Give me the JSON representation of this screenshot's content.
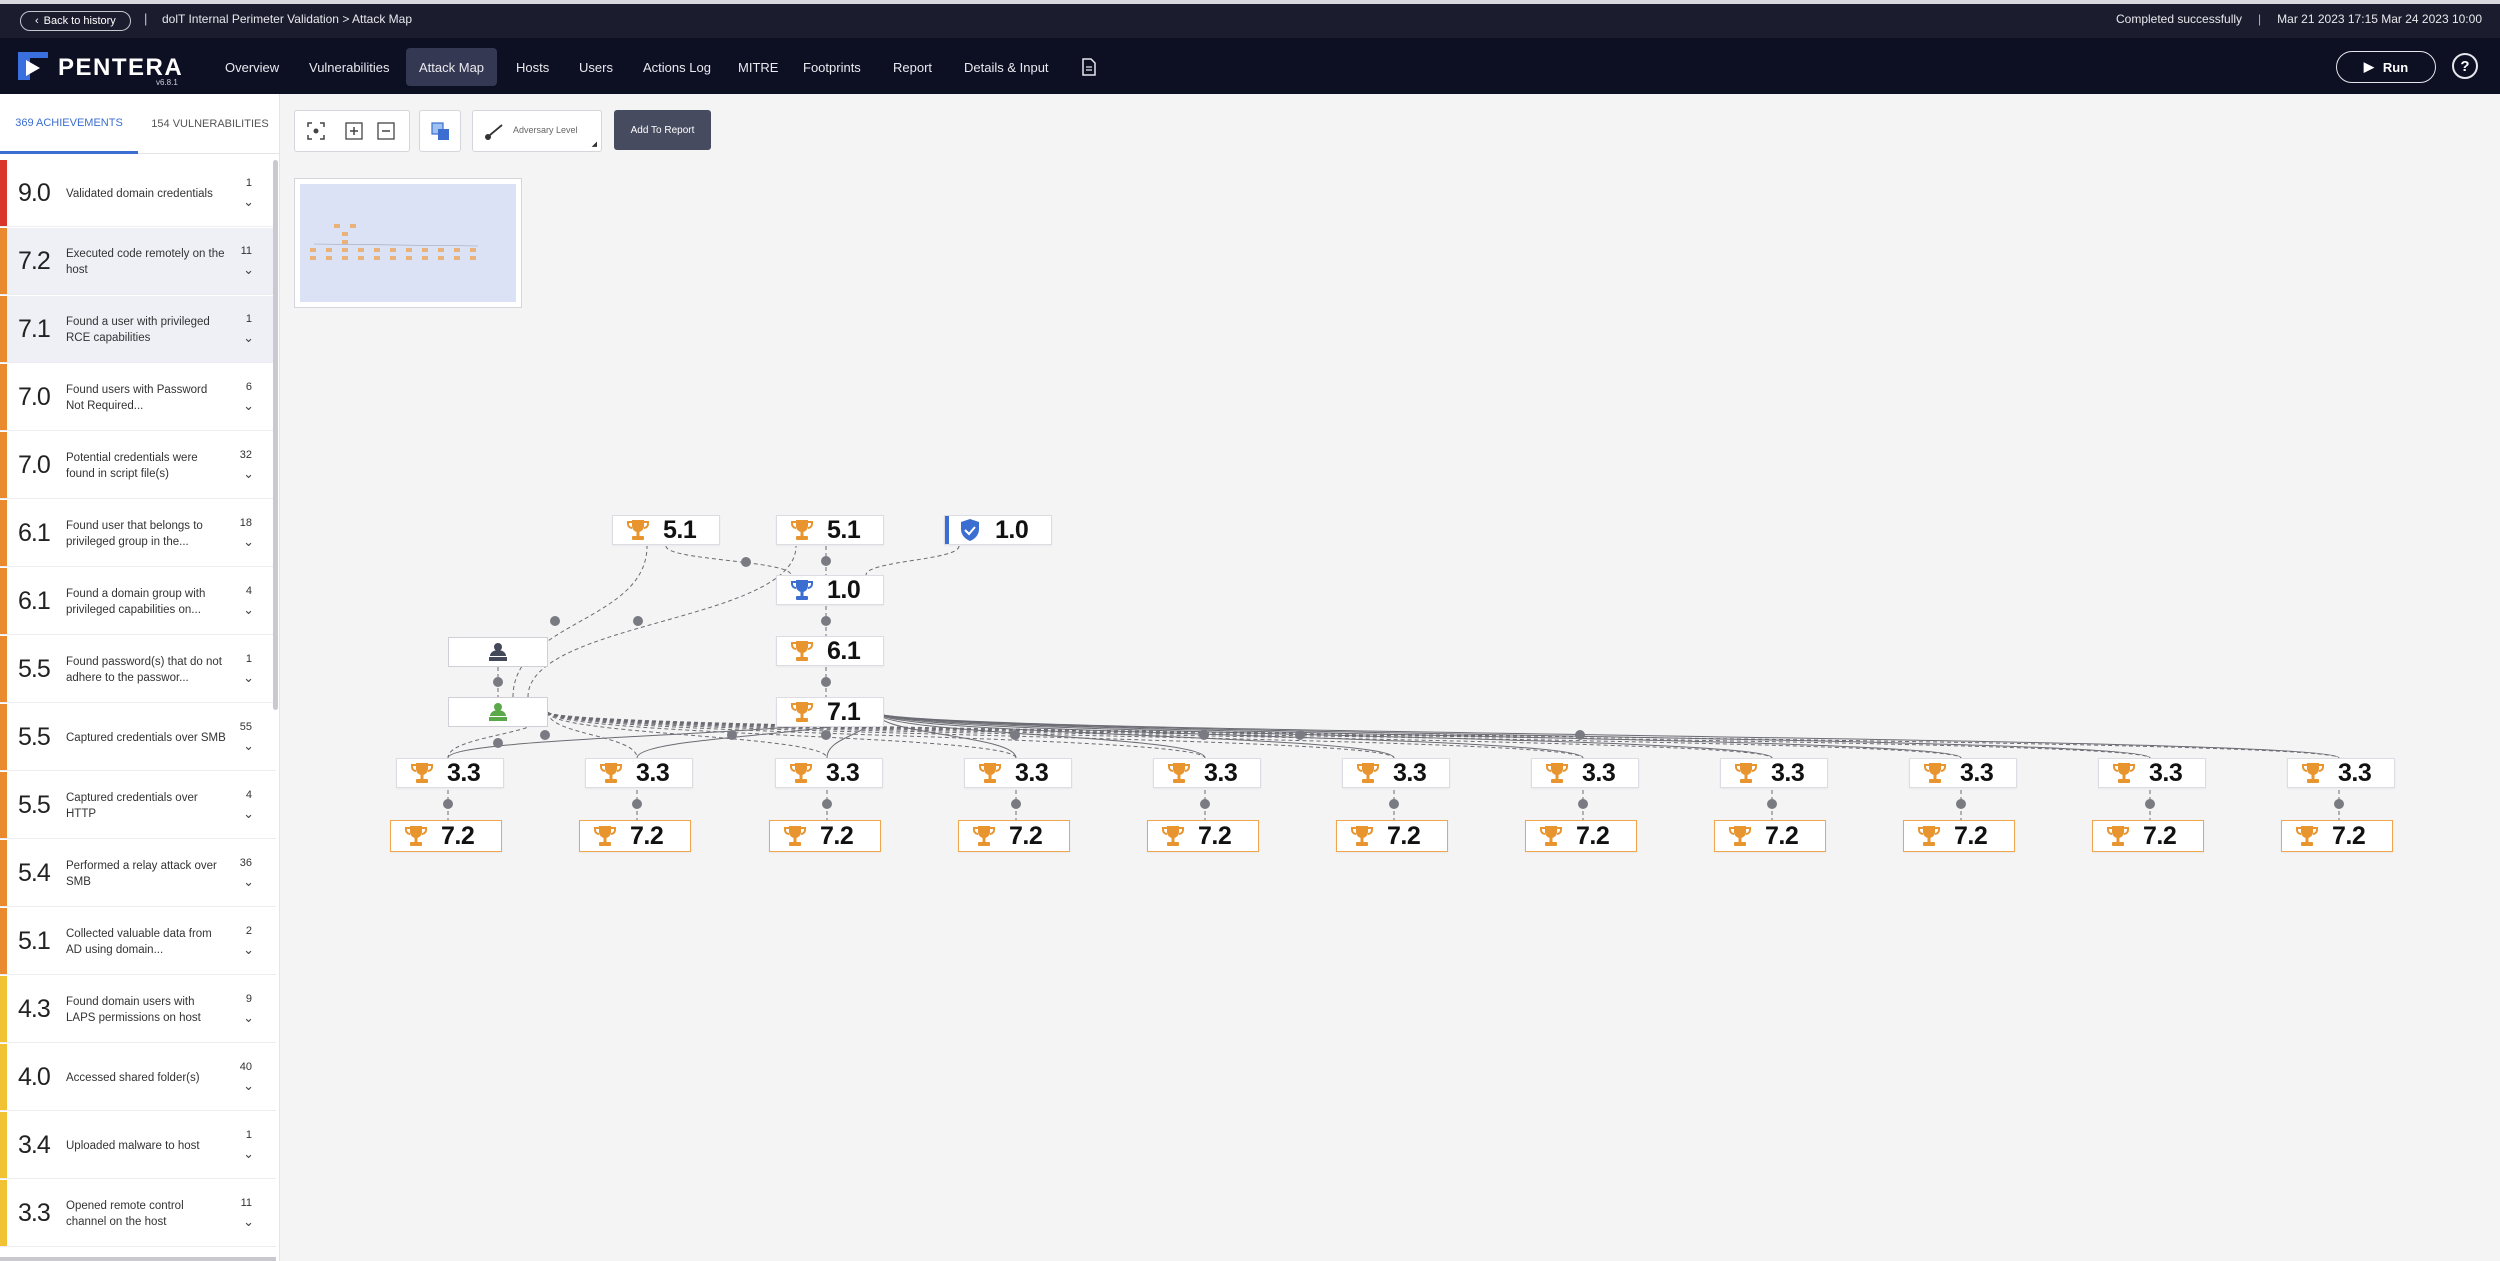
{
  "topbar": {
    "back_label": "Back to history",
    "breadcrumb": "dolT Internal Perimeter Validation > Attack Map",
    "status": "Completed successfully",
    "dates": "Mar 21 2023 17:15  Mar 24 2023 10:00"
  },
  "brand": {
    "name": "PENTERA",
    "version": "v6.8.1"
  },
  "nav": {
    "items": [
      "Overview",
      "Vulnerabilities",
      "Attack Map",
      "Hosts",
      "Users",
      "Actions Log",
      "MITRE",
      "Footprints",
      "Report",
      "Details & Input"
    ],
    "active": "Attack Map",
    "run_label": "Run",
    "help_label": "?"
  },
  "panel": {
    "tabs": [
      "369 ACHIEVEMENTS",
      "154 VULNERABILITIES"
    ],
    "achievements": [
      {
        "score": "9.0",
        "title": "Validated domain credentials",
        "count": "1",
        "color": "#d9362b"
      },
      {
        "score": "7.2",
        "title": "Executed code remotely on the host",
        "count": "11",
        "color": "#e98a2e"
      },
      {
        "score": "7.1",
        "title": "Found a user with privileged RCE capabilities",
        "count": "1",
        "color": "#e98a2e"
      },
      {
        "score": "7.0",
        "title": "Found users with Password Not Required...",
        "count": "6",
        "color": "#e98a2e"
      },
      {
        "score": "7.0",
        "title": "Potential credentials were found in script file(s)",
        "count": "32",
        "color": "#e98a2e"
      },
      {
        "score": "6.1",
        "title": "Found user that belongs to privileged group in the...",
        "count": "18",
        "color": "#e98a2e"
      },
      {
        "score": "6.1",
        "title": "Found a domain group with privileged capabilities on...",
        "count": "4",
        "color": "#e98a2e"
      },
      {
        "score": "5.5",
        "title": "Found password(s) that do not adhere to the passwor...",
        "count": "1",
        "color": "#e98a2e"
      },
      {
        "score": "5.5",
        "title": "Captured credentials over SMB",
        "count": "55",
        "color": "#e98a2e"
      },
      {
        "score": "5.5",
        "title": "Captured credentials over HTTP",
        "count": "4",
        "color": "#e98a2e"
      },
      {
        "score": "5.4",
        "title": "Performed a relay attack over SMB",
        "count": "36",
        "color": "#e98a2e"
      },
      {
        "score": "5.1",
        "title": "Collected valuable data from AD using domain...",
        "count": "2",
        "color": "#e98a2e"
      },
      {
        "score": "4.3",
        "title": "Found domain users with LAPS permissions on host",
        "count": "9",
        "color": "#f2c235"
      },
      {
        "score": "4.0",
        "title": "Accessed shared folder(s)",
        "count": "40",
        "color": "#f2c235"
      },
      {
        "score": "3.4",
        "title": "Uploaded malware to host",
        "count": "1",
        "color": "#f2c235"
      },
      {
        "score": "3.3",
        "title": "Opened remote control channel on the host",
        "count": "11",
        "color": "#f2c235"
      }
    ]
  },
  "toolbar": {
    "adversary_level": "Adversary Level",
    "add_report": "Add To Report"
  },
  "graph": {
    "top_nodes": [
      {
        "score": "5.1",
        "kind": "trophy"
      },
      {
        "score": "5.1",
        "kind": "trophy"
      },
      {
        "score": "1.0",
        "kind": "shield"
      }
    ],
    "chain_nodes": [
      {
        "score": "1.0",
        "kind": "trophy-blue"
      },
      {
        "score": "6.1",
        "kind": "trophy"
      },
      {
        "score": "7.1",
        "kind": "trophy"
      }
    ],
    "row_a": [
      "3.3",
      "3.3",
      "3.3",
      "3.3",
      "3.3",
      "3.3",
      "3.3",
      "3.3",
      "3.3",
      "3.3",
      "3.3"
    ],
    "row_b": [
      "7.2",
      "7.2",
      "7.2",
      "7.2",
      "7.2",
      "7.2",
      "7.2",
      "7.2",
      "7.2",
      "7.2",
      "7.2"
    ]
  }
}
